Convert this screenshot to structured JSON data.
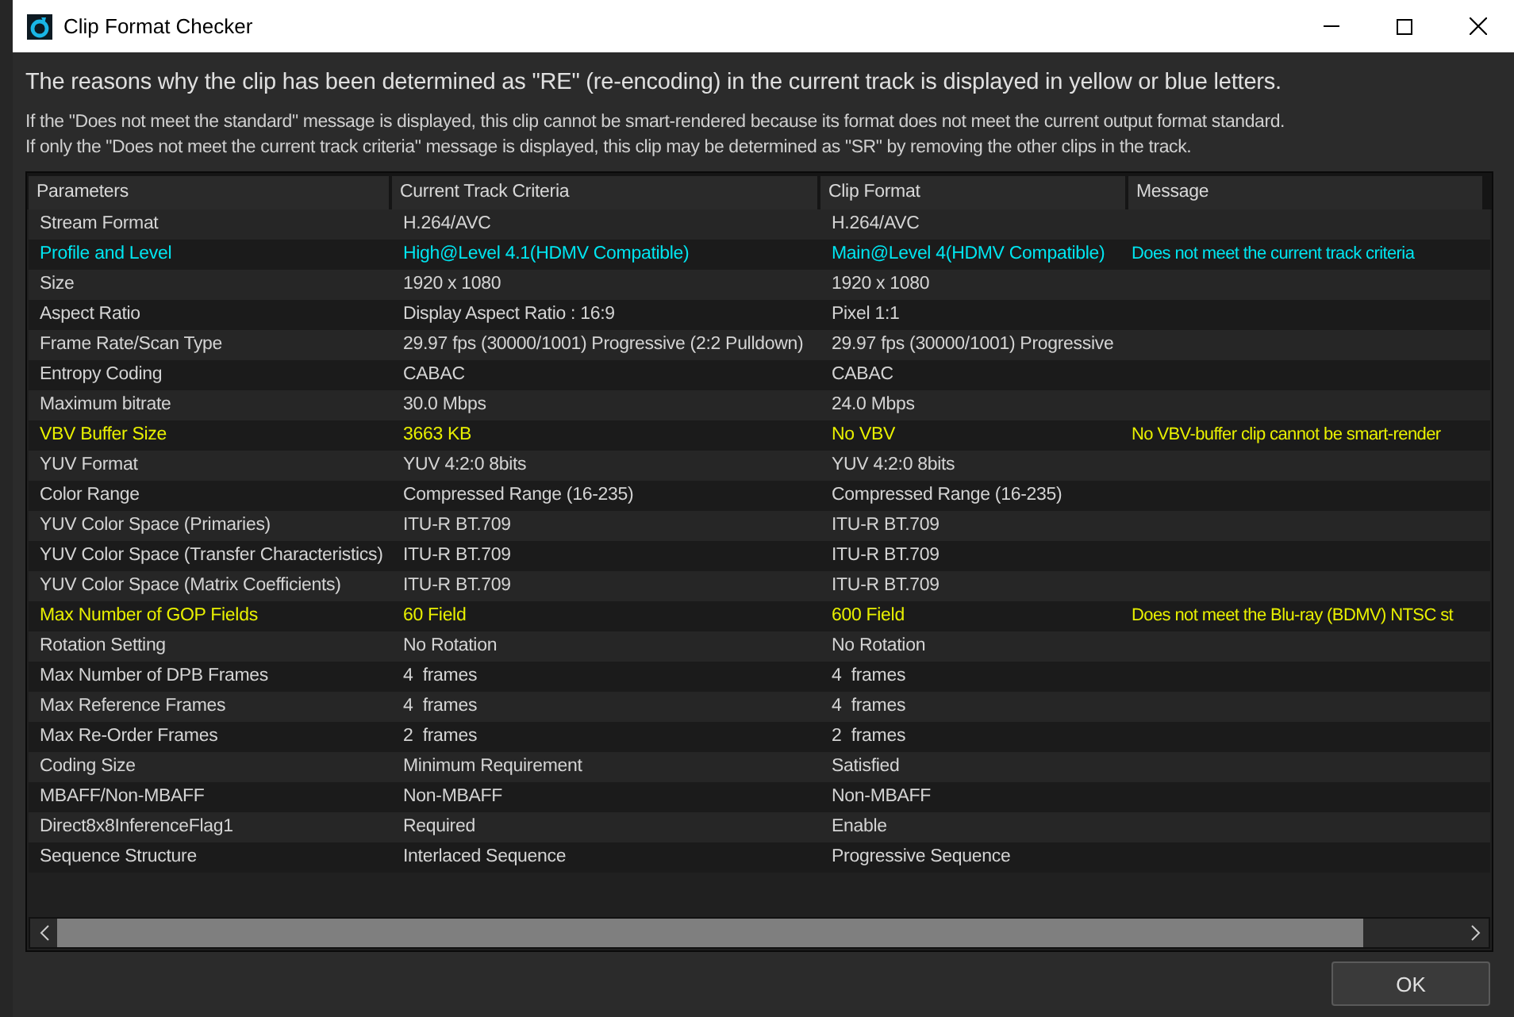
{
  "window": {
    "title": "Clip Format Checker"
  },
  "heading": "The reasons why the clip has been determined as \"RE\" (re-encoding) in the current track is displayed in yellow or blue letters.",
  "notes": [
    "If the \"Does not meet the standard\" message is displayed, this clip cannot be smart-rendered because its format does not meet the current output format standard.",
    "If only the \"Does not meet the current track criteria\" message is displayed, this clip may be determined as \"SR\" by removing the other clips in the track."
  ],
  "table": {
    "columns": [
      "Parameters",
      "Current Track Criteria",
      "Clip Format",
      "Message"
    ],
    "rows": [
      {
        "kind": "plain",
        "cells": [
          "Stream Format",
          "H.264/AVC",
          "H.264/AVC",
          ""
        ]
      },
      {
        "kind": "track",
        "cells": [
          "Profile and Level",
          "High@Level 4.1(HDMV Compatible)",
          "Main@Level 4(HDMV Compatible)",
          "Does not meet the current track criteria"
        ]
      },
      {
        "kind": "plain",
        "cells": [
          "Size",
          "1920 x 1080",
          "1920 x 1080",
          ""
        ]
      },
      {
        "kind": "plain",
        "cells": [
          "Aspect Ratio",
          "Display Aspect Ratio : 16:9",
          "Pixel 1:1",
          ""
        ]
      },
      {
        "kind": "plain",
        "cells": [
          "Frame Rate/Scan Type",
          "29.97 fps (30000/1001) Progressive (2:2 Pulldown)",
          "29.97 fps (30000/1001) Progressive",
          ""
        ]
      },
      {
        "kind": "plain",
        "cells": [
          "Entropy Coding",
          "CABAC",
          "CABAC",
          ""
        ]
      },
      {
        "kind": "plain",
        "cells": [
          "Maximum bitrate",
          "30.0 Mbps",
          "24.0 Mbps",
          ""
        ]
      },
      {
        "kind": "standard",
        "cells": [
          "VBV Buffer Size",
          "3663 KB",
          "No VBV",
          "No VBV-buffer clip cannot be smart-render"
        ]
      },
      {
        "kind": "plain",
        "cells": [
          "YUV Format",
          "YUV 4:2:0 8bits",
          "YUV 4:2:0 8bits",
          ""
        ]
      },
      {
        "kind": "plain",
        "cells": [
          "Color Range",
          "Compressed Range (16-235)",
          "Compressed Range (16-235)",
          ""
        ]
      },
      {
        "kind": "plain",
        "cells": [
          "YUV Color Space (Primaries)",
          "ITU-R BT.709",
          "ITU-R BT.709",
          ""
        ]
      },
      {
        "kind": "plain",
        "cells": [
          "YUV Color Space (Transfer Characteristics)",
          "ITU-R BT.709",
          "ITU-R BT.709",
          ""
        ]
      },
      {
        "kind": "plain",
        "cells": [
          "YUV Color Space (Matrix Coefficients)",
          "ITU-R BT.709",
          "ITU-R BT.709",
          ""
        ]
      },
      {
        "kind": "standard",
        "cells": [
          "Max Number of GOP Fields",
          "60 Field",
          "600 Field",
          "Does not meet the Blu-ray (BDMV) NTSC st"
        ]
      },
      {
        "kind": "plain",
        "cells": [
          "Rotation Setting",
          "No Rotation",
          "No Rotation",
          ""
        ]
      },
      {
        "kind": "plain",
        "cells": [
          "Max Number of DPB Frames",
          "4  frames",
          "4  frames",
          ""
        ]
      },
      {
        "kind": "plain",
        "cells": [
          "Max Reference Frames",
          "4  frames",
          "4  frames",
          ""
        ]
      },
      {
        "kind": "plain",
        "cells": [
          "Max Re-Order Frames",
          "2  frames",
          "2  frames",
          ""
        ]
      },
      {
        "kind": "plain",
        "cells": [
          "Coding Size",
          "Minimum Requirement",
          "Satisfied",
          ""
        ]
      },
      {
        "kind": "plain",
        "cells": [
          "MBAFF/Non-MBAFF",
          "Non-MBAFF",
          "Non-MBAFF",
          ""
        ]
      },
      {
        "kind": "plain",
        "cells": [
          "Direct8x8InferenceFlag1",
          "Required",
          "Enable",
          ""
        ]
      },
      {
        "kind": "plain",
        "cells": [
          "Sequence Structure",
          "Interlaced Sequence",
          "Progressive Sequence",
          ""
        ]
      }
    ]
  },
  "buttons": [
    "OK"
  ]
}
